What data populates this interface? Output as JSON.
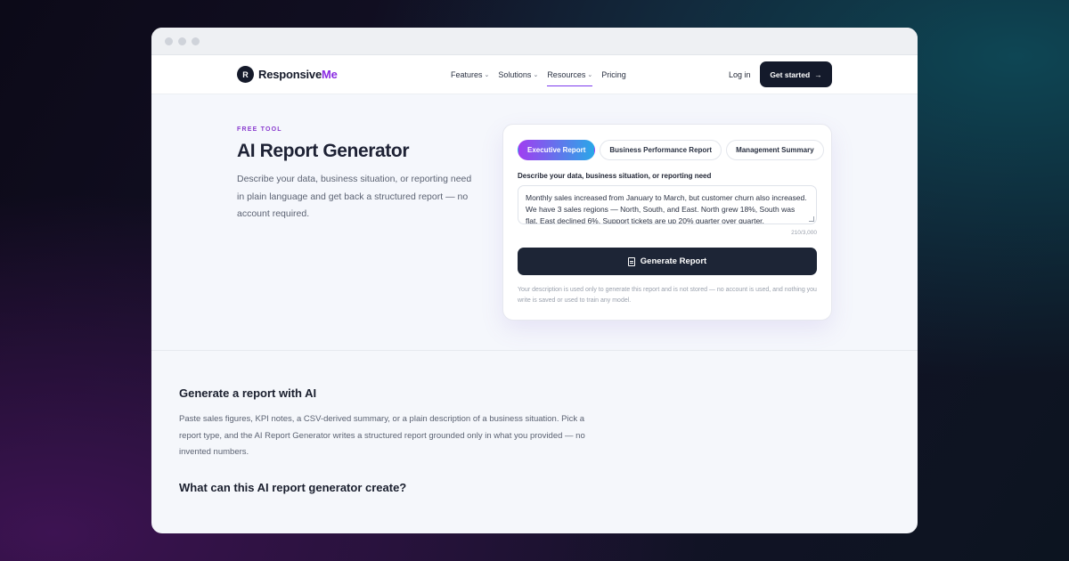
{
  "brand": {
    "mark": "R",
    "name_main": "Responsive",
    "name_accent": "Me"
  },
  "nav": {
    "items": [
      {
        "label": "Features",
        "chevron": true
      },
      {
        "label": "Solutions",
        "chevron": true
      },
      {
        "label": "Resources",
        "chevron": true
      },
      {
        "label": "Pricing",
        "chevron": false
      }
    ],
    "login": "Log in",
    "cta": "Get started",
    "cta_arrow": "→",
    "chevron_glyph": "⌄"
  },
  "hero": {
    "eyebrow": "FREE TOOL",
    "title": "AI Report Generator",
    "description": "Describe your data, business situation, or reporting need in plain language and get back a structured report — no account required."
  },
  "form": {
    "tabs": [
      "Executive Report",
      "Business Performance Report",
      "Management Summary"
    ],
    "active_tab": "Executive Report",
    "field_label": "Describe your data, business situation, or reporting need",
    "textarea_value": "Monthly sales increased from January to March, but customer churn also increased. We have 3 sales regions — North, South, and East. North grew 18%, South was flat, East declined 6%. Support tickets are up 20% quarter over quarter.",
    "counter": "210/3,000",
    "generate_label": "Generate Report",
    "privacy": "Your description is used only to generate this report and is not stored — no account is used, and nothing you write is saved or used to train any model."
  },
  "content": {
    "heading1": "Generate a report with AI",
    "paragraph1": "Paste sales figures, KPI notes, a CSV-derived summary, or a plain description of a business situation. Pick a report type, and the AI Report Generator writes a structured report grounded only in what you provided — no invented numbers.",
    "heading2": "What can this AI report generator create?"
  },
  "colors": {
    "brand_accent": "#8a2be2",
    "cta_bg": "#141a2b",
    "active_tab_gradient_start": "#a03ef0",
    "active_tab_gradient_end": "#2aa7e8",
    "generate_bg": "#1d2536"
  },
  "icons": [
    "chevron-down-icon",
    "arrow-right-icon",
    "document-icon",
    "resize-handle-icon"
  ]
}
